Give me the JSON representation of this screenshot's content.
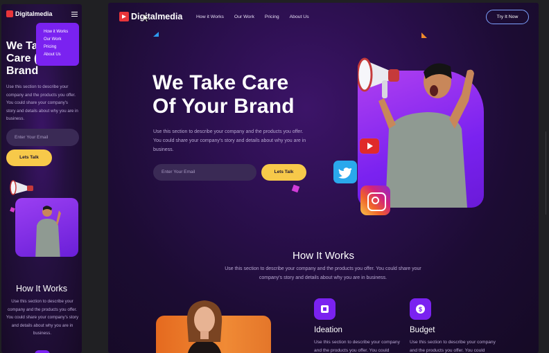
{
  "mobile": {
    "logo": "Digitalmedia",
    "menu": [
      "How it Works",
      "Our Work",
      "Pricing",
      "About Us"
    ],
    "hero_lines": [
      "We Ta",
      "Care (",
      "Brand"
    ],
    "description": "Use this section to describe your company and the products you offer. You could share your company's story and details about why you are in business.",
    "email_placeholder": "Enter Your Email",
    "cta": "Lets Talk",
    "how_title": "How It Works",
    "how_desc": "Use this section to describe your company and the products you offer. You could share your company's story and details about why you are in business."
  },
  "desktop": {
    "logo": "Digitalmedia",
    "nav": [
      "How it Works",
      "Our Work",
      "Pricing",
      "About Us"
    ],
    "try_button": "Try It Now",
    "hero_lines": [
      "We Take Care",
      "Of Your Brand"
    ],
    "description": "Use this section to describe your company and the products you offer. You could share your company's story and details about why you are in business.",
    "email_placeholder": "Enter Your Email",
    "cta": "Lets Talk",
    "how_title": "How It Works",
    "how_desc": "Use this section to describe your company and the products you offer. You could share your company's story and details about why you are in business.",
    "features": [
      {
        "title": "Ideation",
        "desc": "Use this section to describe your company and the products you offer. You could",
        "icon": "ideation-icon"
      },
      {
        "title": "Budget",
        "desc": "Use this section to describe your company and the products you offer. You could",
        "icon": "dollar-icon"
      }
    ]
  },
  "colors": {
    "accent": "#7a22f0",
    "cta": "#f7c94a",
    "logo_mark": "#e8353a",
    "outline_button": "#7ea2ff"
  }
}
